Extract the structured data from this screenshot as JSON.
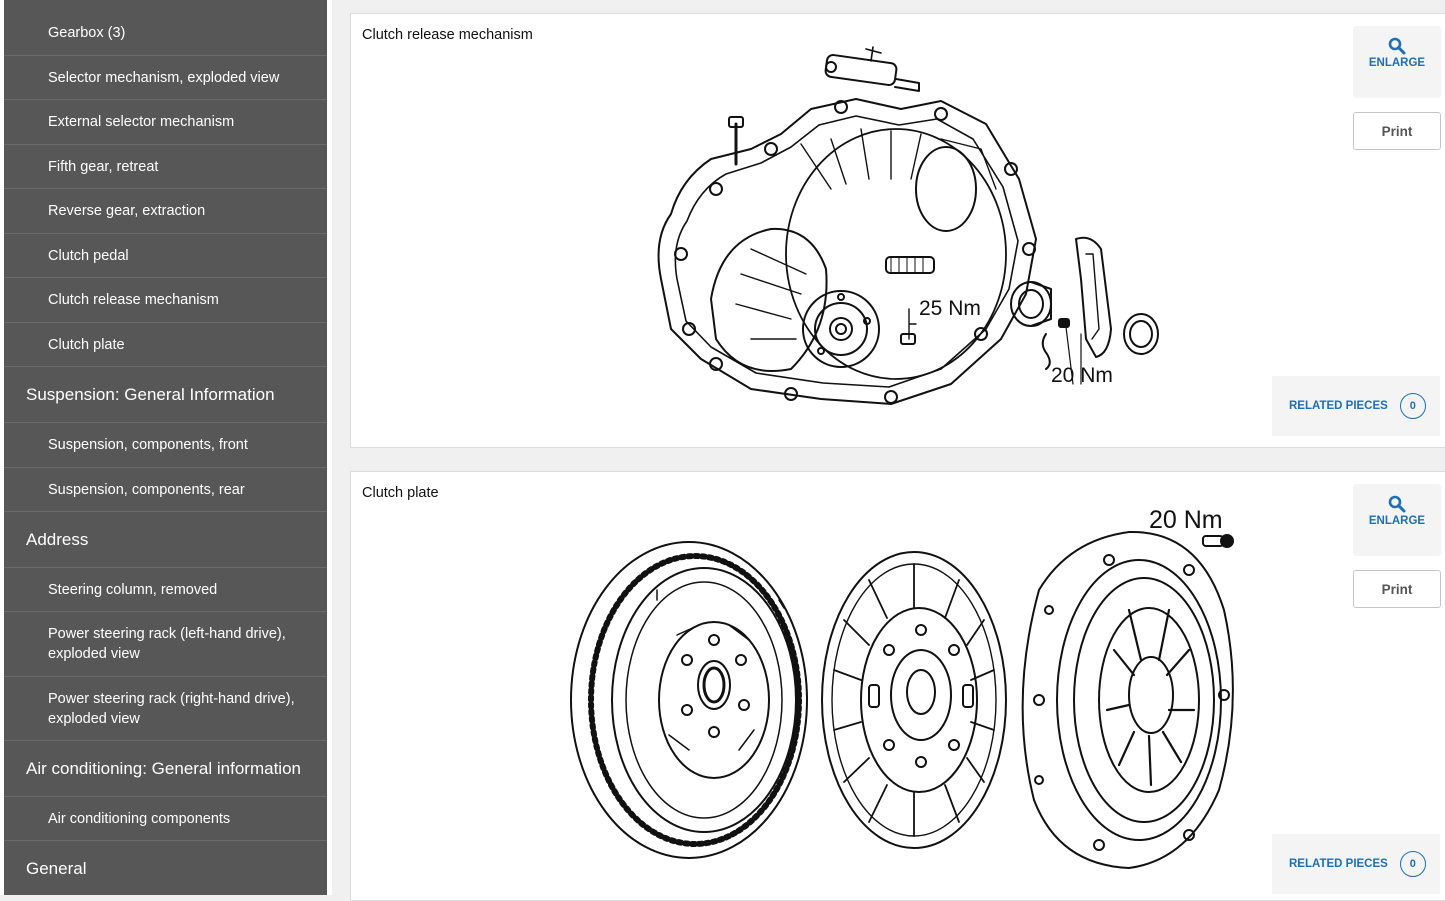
{
  "sidebar": {
    "items": [
      {
        "label": "Gearbox (3)",
        "type": "sub"
      },
      {
        "label": "Selector mechanism, exploded view",
        "type": "sub"
      },
      {
        "label": "External selector mechanism",
        "type": "sub"
      },
      {
        "label": "Fifth gear, retreat",
        "type": "sub"
      },
      {
        "label": "Reverse gear, extraction",
        "type": "sub"
      },
      {
        "label": "Clutch pedal",
        "type": "sub"
      },
      {
        "label": "Clutch release mechanism",
        "type": "sub"
      },
      {
        "label": "Clutch plate",
        "type": "sub"
      },
      {
        "label": "Suspension: General Information",
        "type": "section"
      },
      {
        "label": "Suspension, components, front",
        "type": "sub"
      },
      {
        "label": "Suspension, components, rear",
        "type": "sub"
      },
      {
        "label": "Address",
        "type": "section"
      },
      {
        "label": "Steering column, removed",
        "type": "sub"
      },
      {
        "label": "Power steering rack (left-hand drive), exploded view",
        "type": "sub"
      },
      {
        "label": "Power steering rack (right-hand drive), exploded view",
        "type": "sub"
      },
      {
        "label": "Air conditioning: General information",
        "type": "section"
      },
      {
        "label": "Air conditioning components",
        "type": "sub"
      },
      {
        "label": "General",
        "type": "section"
      }
    ]
  },
  "cards": [
    {
      "title": "Clutch release mechanism",
      "torque_labels": [
        "25 Nm",
        "20 Nm"
      ],
      "enlarge_label": "ENLARGE",
      "print_label": "Print",
      "related_label": "RELATED PIECES",
      "related_count": "0"
    },
    {
      "title": "Clutch plate",
      "torque_labels": [
        "20 Nm"
      ],
      "enlarge_label": "ENLARGE",
      "print_label": "Print",
      "related_label": "RELATED PIECES",
      "related_count": "0"
    }
  ],
  "colors": {
    "sidebar_bg": "#575757",
    "accent": "#1d6fb8",
    "page_bg": "#f0f0f0"
  },
  "icons": {
    "enlarge": "magnifier-icon"
  }
}
